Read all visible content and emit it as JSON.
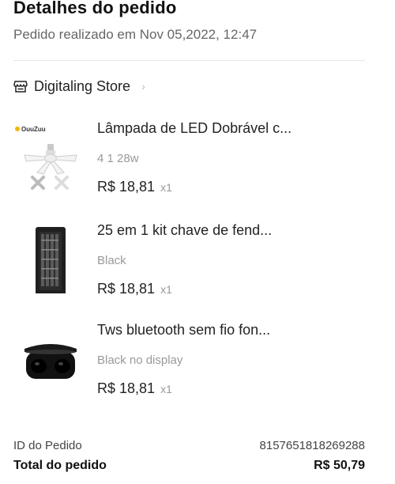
{
  "header": {
    "title": "Detalhes do pedido",
    "placed_at": "Pedido realizado em Nov 05,2022, 12:47"
  },
  "store": {
    "name": "Digitaling Store",
    "chevron": "›",
    "icon": "store-icon"
  },
  "items": [
    {
      "name": "Lâmpada de LED Dobrável c...",
      "variant": "4 1 28w",
      "price": "R$ 18,81",
      "qty": "x1",
      "brand_mark": "OuuZuu"
    },
    {
      "name": "25 em 1 kit chave de fend...",
      "variant": "Black",
      "price": "R$ 18,81",
      "qty": "x1"
    },
    {
      "name": "Tws bluetooth sem fio fon...",
      "variant": "Black no display",
      "price": "R$ 18,81",
      "qty": "x1"
    }
  ],
  "summary": {
    "order_id_label": "ID do Pedido",
    "order_id_value": "8157651818269288",
    "total_label": "Total do pedido",
    "total_value": "R$ 50,79"
  }
}
